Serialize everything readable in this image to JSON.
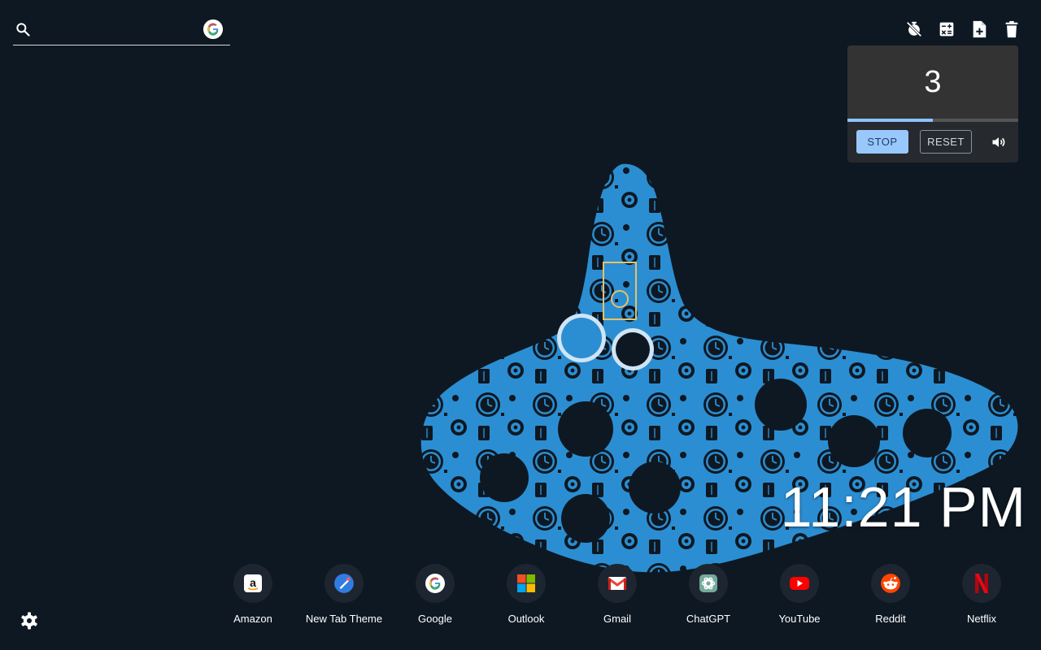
{
  "search": {
    "placeholder": "",
    "value": ""
  },
  "toolbar": {
    "icons": [
      "timer-off-icon",
      "calculator-icon",
      "new-note-icon",
      "trash-icon"
    ]
  },
  "timer": {
    "value": "3",
    "progress": 0.5,
    "stop_label": "STOP",
    "reset_label": "RESET"
  },
  "clock": {
    "time": "11:21 PM"
  },
  "shortcuts": [
    {
      "label": "Amazon",
      "icon": "amazon-icon"
    },
    {
      "label": "New Tab Theme",
      "icon": "new-tab-theme-icon"
    },
    {
      "label": "Google",
      "icon": "google-icon"
    },
    {
      "label": "Outlook",
      "icon": "outlook-icon"
    },
    {
      "label": "Gmail",
      "icon": "gmail-icon"
    },
    {
      "label": "ChatGPT",
      "icon": "chatgpt-icon"
    },
    {
      "label": "YouTube",
      "icon": "youtube-icon"
    },
    {
      "label": "Reddit",
      "icon": "reddit-icon"
    },
    {
      "label": "Netflix",
      "icon": "netflix-icon"
    }
  ],
  "colors": {
    "background": "#0e1822",
    "accent": "#99c8ff",
    "art": "#2f8fd0"
  }
}
